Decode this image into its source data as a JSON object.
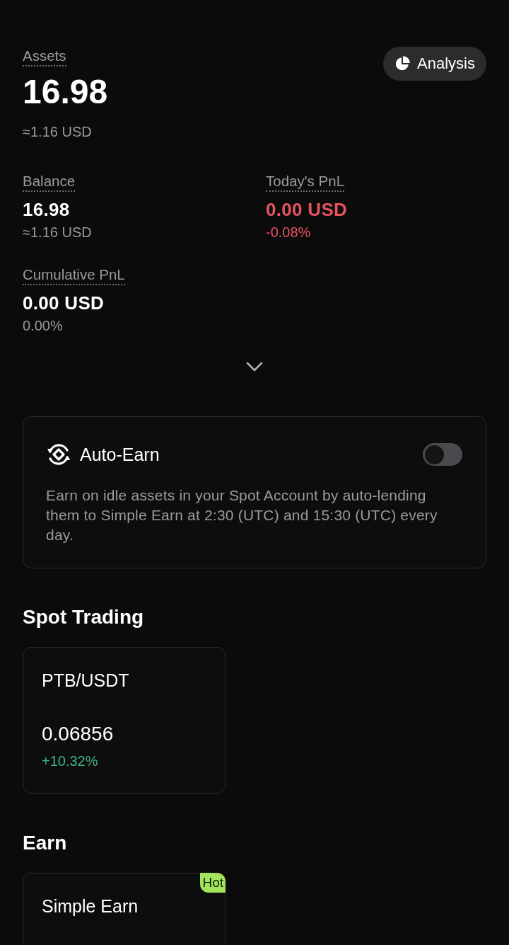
{
  "header": {
    "label": "Assets",
    "value": "16.98",
    "approx": "≈1.16 USD",
    "analysis_button": "Analysis"
  },
  "stats": [
    {
      "label": "Balance",
      "value": "16.98",
      "sub": "≈1.16 USD",
      "negative": false
    },
    {
      "label": "Today's PnL",
      "value": "0.00 USD",
      "sub": "-0.08%",
      "negative": true
    },
    {
      "label": "Cumulative PnL",
      "value": "0.00 USD",
      "sub": "0.00%",
      "negative": false
    }
  ],
  "stats_expanded": false,
  "auto_earn": {
    "title": "Auto-Earn",
    "on": false,
    "description": "Earn on idle assets in your Spot Account by auto-lending them to Simple Earn at 2:30 (UTC) and 15:30 (UTC) every day."
  },
  "spot_trading": {
    "title": "Spot Trading",
    "pairs": [
      {
        "symbol": "PTB/USDT",
        "price": "0.06856",
        "change": "+10.32%",
        "positive": true
      }
    ]
  },
  "earn": {
    "title": "Earn",
    "products": [
      {
        "name": "Simple Earn",
        "badge": "Hot"
      }
    ]
  }
}
